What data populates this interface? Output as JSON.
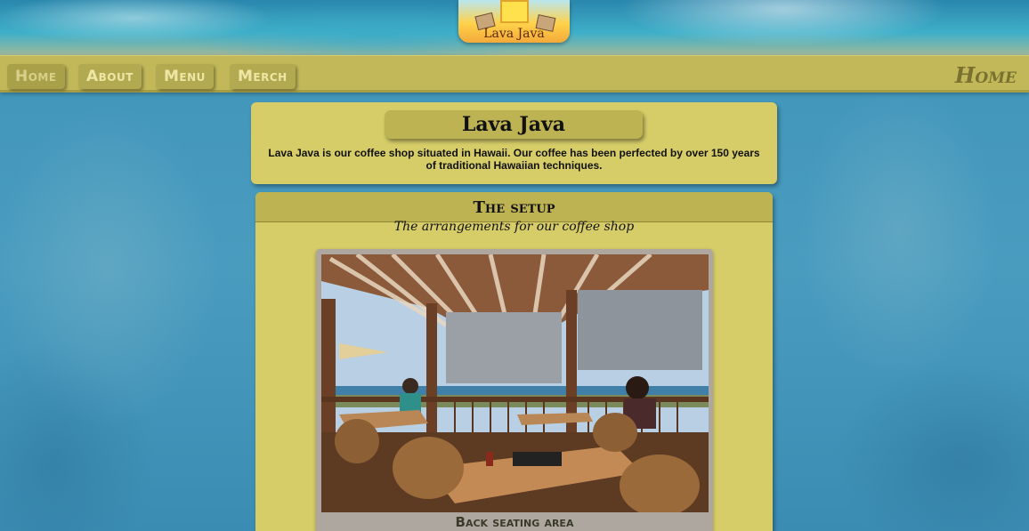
{
  "logo": {
    "text": "Lava Java"
  },
  "nav": {
    "items": [
      {
        "label": "Home",
        "active": true
      },
      {
        "label": "About",
        "active": false
      },
      {
        "label": "Menu",
        "active": false
      },
      {
        "label": "Merch",
        "active": false
      }
    ],
    "current_page": "Home"
  },
  "intro": {
    "title": "Lava Java",
    "text": "Lava Java is our coffee shop situated in Hawaii. Our coffee has been perfected by over 150 years of traditional Hawaiian techniques."
  },
  "setup": {
    "title": "The setup",
    "subtitle": "The arrangements for our coffee shop",
    "photo_caption": "Back seating area"
  },
  "colors": {
    "nav_bg": "#c2b85a",
    "card_bg": "#d6cc68",
    "header_bg": "#bdb352"
  }
}
